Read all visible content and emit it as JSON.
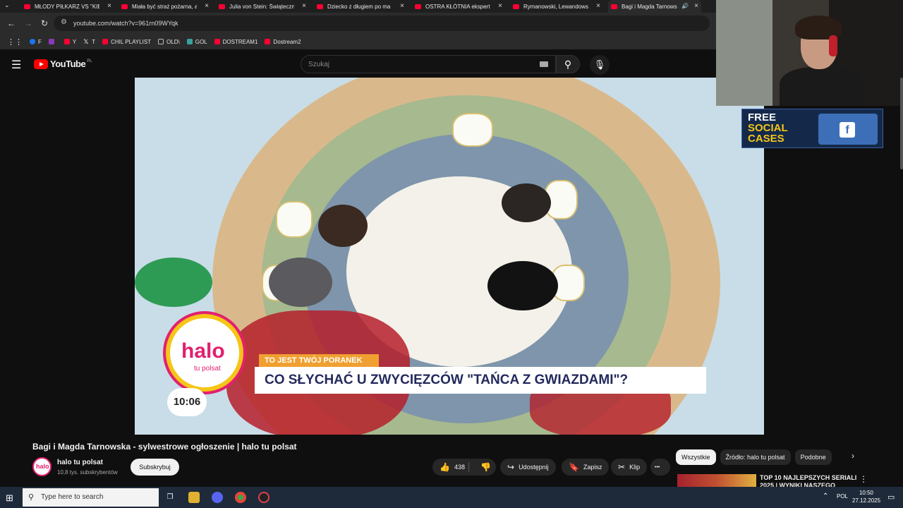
{
  "browser": {
    "tabs": [
      {
        "title": "MŁODY PIŁKARZ VS \"KIBI"
      },
      {
        "title": "Miała być straż pożarna, a"
      },
      {
        "title": "Julia von Stein: Świąteczn"
      },
      {
        "title": "Dziecko z długiem po ma"
      },
      {
        "title": "OSTRA KŁÓTNIA eksperta"
      },
      {
        "title": "Rymanowski, Lewandows"
      },
      {
        "title": "Bagi i Magda Tarnows"
      }
    ],
    "close_glyph": "×",
    "url": "youtube.com/watch?v=961rn09WYqk",
    "bookmarks": [
      {
        "label": "F",
        "color": "#1877f2"
      },
      {
        "label": "",
        "color": "#8a3ab9"
      },
      {
        "label": "Y",
        "color": "#ff0033"
      },
      {
        "label": "T",
        "color": "#ffffff"
      },
      {
        "label": "CHIL PLAYLIST",
        "color": "#ff0033"
      },
      {
        "label": "OLD\\",
        "color": "#bbbbbb"
      },
      {
        "label": "GOL",
        "color": "#3aa0a0"
      },
      {
        "label": "DOSTREAM1",
        "color": "#ff0033"
      },
      {
        "label": "Dostream2",
        "color": "#ff0033"
      }
    ]
  },
  "youtube": {
    "logo_text": "YouTube",
    "logo_country": "PL",
    "search_placeholder": "Szukaj"
  },
  "video": {
    "overlay_logo": "halo",
    "overlay_logo_sub": "tu polsat",
    "clock": "10:06",
    "banner_small": "TO JEST TWÓJ PORANEK",
    "banner_main": "CO SŁYCHAĆ U ZWYCIĘZCÓW \"TAŃCA Z GWIAZDAMI\"?"
  },
  "promo": {
    "line1": "FREE",
    "line2": "SOCIAL",
    "line3": "CASES",
    "icon": "f"
  },
  "watch": {
    "title": "Bagi i Magda Tarnowska - sylwestrowe ogłoszenie | halo tu polsat",
    "channel_name": "halo tu polsat",
    "channel_avatar_text": "halo",
    "subscribers": "10,8 tys. subskrybentów",
    "subscribe_label": "Subskrybuj",
    "likes": "438",
    "share_label": "Udostępnij",
    "save_label": "Zapisz",
    "clip_label": "Klip",
    "more_glyph": "•••"
  },
  "chips": [
    "Wszystkie",
    "Źródło: halo tu polsat",
    "Podobne"
  ],
  "recommendation": {
    "title": "TOP 10 NAJLEPSZYCH SERIALI 2025 | WYNIKI NASZEGO"
  },
  "taskbar": {
    "search_placeholder": "Type here to search",
    "lang": "POL",
    "time": "10:50",
    "date": "27.12.2025"
  }
}
